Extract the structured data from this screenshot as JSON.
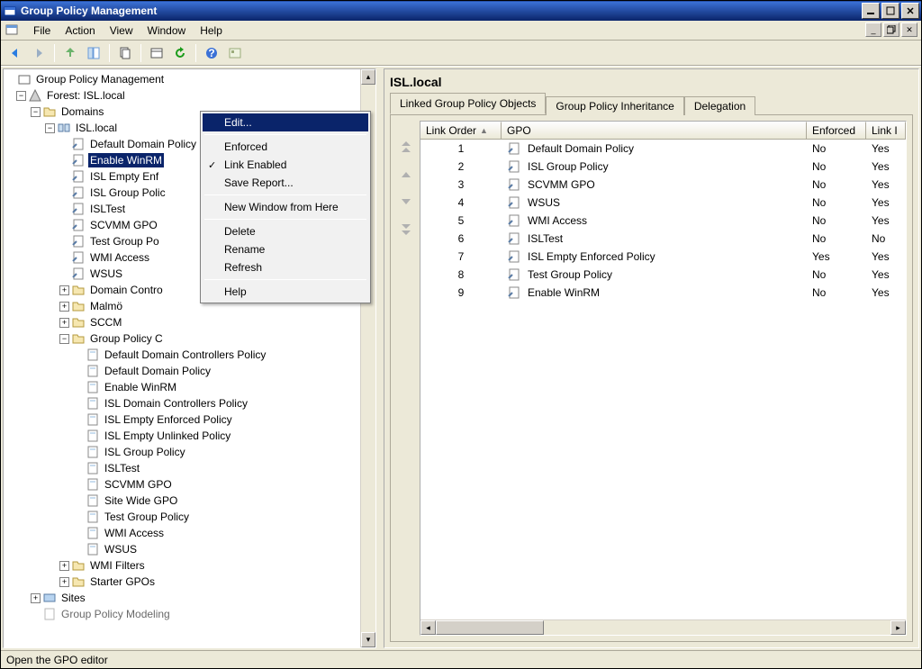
{
  "window": {
    "title": "Group Policy Management"
  },
  "menubar": [
    "File",
    "Action",
    "View",
    "Window",
    "Help"
  ],
  "tree": {
    "root": "Group Policy Management",
    "forest": "Forest: ISL.local",
    "domains": "Domains",
    "domain": "ISL.local",
    "gp_links": [
      "Default Domain Policy",
      "Enable WinRM",
      "ISL Empty Enf",
      "ISL Group Polic",
      "ISLTest",
      "SCVMM GPO",
      "Test Group Po",
      "WMI Access",
      "WSUS"
    ],
    "ous": [
      "Domain Contro",
      "Malmö",
      "SCCM"
    ],
    "gpo_container": "Group Policy C",
    "gpos": [
      "Default Domain Controllers Policy",
      "Default Domain Policy",
      "Enable WinRM",
      "ISL Domain Controllers Policy",
      "ISL Empty Enforced Policy",
      "ISL Empty Unlinked Policy",
      "ISL Group Policy",
      "ISLTest",
      "SCVMM GPO",
      "Site Wide GPO",
      "Test Group Policy",
      "WMI Access",
      "WSUS"
    ],
    "wmi_filters": "WMI Filters",
    "starter_gpos": "Starter GPOs",
    "sites": "Sites",
    "modeling": "Group Policy Modeling"
  },
  "context_menu": {
    "edit": "Edit...",
    "enforced": "Enforced",
    "link_enabled": "Link Enabled",
    "save_report": "Save Report...",
    "new_window": "New Window from Here",
    "delete": "Delete",
    "rename": "Rename",
    "refresh": "Refresh",
    "help": "Help"
  },
  "right": {
    "title": "ISL.local",
    "tabs": [
      "Linked Group Policy Objects",
      "Group Policy Inheritance",
      "Delegation"
    ],
    "columns": {
      "order": "Link Order",
      "gpo": "GPO",
      "enforced": "Enforced",
      "link": "Link I"
    },
    "rows": [
      {
        "order": "1",
        "gpo": "Default Domain Policy",
        "enforced": "No",
        "link": "Yes"
      },
      {
        "order": "2",
        "gpo": "ISL Group Policy",
        "enforced": "No",
        "link": "Yes"
      },
      {
        "order": "3",
        "gpo": "SCVMM GPO",
        "enforced": "No",
        "link": "Yes"
      },
      {
        "order": "4",
        "gpo": "WSUS",
        "enforced": "No",
        "link": "Yes"
      },
      {
        "order": "5",
        "gpo": "WMI Access",
        "enforced": "No",
        "link": "Yes"
      },
      {
        "order": "6",
        "gpo": "ISLTest",
        "enforced": "No",
        "link": "No"
      },
      {
        "order": "7",
        "gpo": "ISL Empty Enforced Policy",
        "enforced": "Yes",
        "link": "Yes"
      },
      {
        "order": "8",
        "gpo": "Test Group Policy",
        "enforced": "No",
        "link": "Yes"
      },
      {
        "order": "9",
        "gpo": "Enable WinRM",
        "enforced": "No",
        "link": "Yes"
      }
    ]
  },
  "status": "Open the GPO editor"
}
